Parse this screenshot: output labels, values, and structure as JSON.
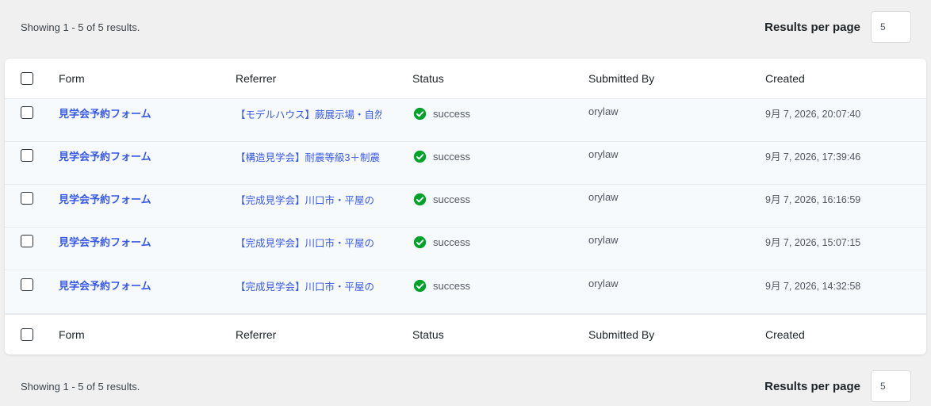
{
  "pagination": {
    "showing_text": "Showing 1 - 5 of 5 results.",
    "results_per_page_label": "Results per page",
    "results_per_page_value": "5"
  },
  "table": {
    "columns": [
      "Form",
      "Referrer",
      "Status",
      "Submitted By",
      "Created"
    ],
    "rows": [
      {
        "form": "見学会予約フォーム",
        "referrer": "【モデルハウス】蕨展示場・自然素材",
        "status": "success",
        "submitted_by": "orylaw",
        "created": "9月 7, 2026, 20:07:40"
      },
      {
        "form": "見学会予約フォーム",
        "referrer": "【構造見学会】耐震等級3＋制震",
        "status": "success",
        "submitted_by": "orylaw",
        "created": "9月 7, 2026, 17:39:46"
      },
      {
        "form": "見学会予約フォーム",
        "referrer": "【完成見学会】川口市・平屋の",
        "status": "success",
        "submitted_by": "orylaw",
        "created": "9月 7, 2026, 16:16:59"
      },
      {
        "form": "見学会予約フォーム",
        "referrer": "【完成見学会】川口市・平屋の",
        "status": "success",
        "submitted_by": "orylaw",
        "created": "9月 7, 2026, 15:07:15"
      },
      {
        "form": "見学会予約フォーム",
        "referrer": "【完成見学会】川口市・平屋の",
        "status": "success",
        "submitted_by": "orylaw",
        "created": "9月 7, 2026, 14:32:58"
      }
    ]
  },
  "colors": {
    "link": "#3858e9",
    "success": "#00a32a",
    "row_background": "#f6fafd"
  },
  "icons": {
    "status": "check-circle-icon"
  }
}
